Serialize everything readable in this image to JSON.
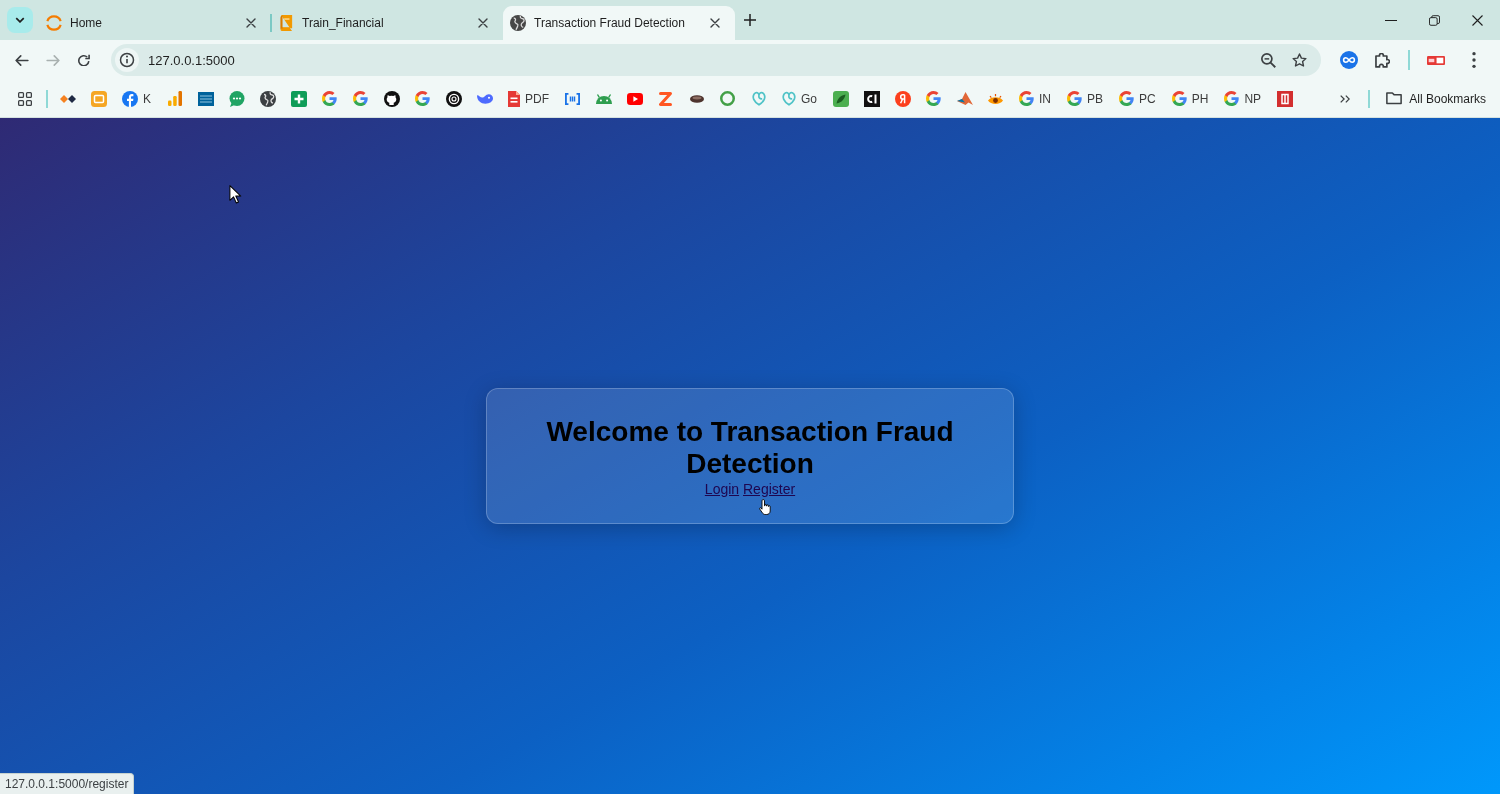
{
  "browser": {
    "tabs": [
      {
        "kind": "ring",
        "title": "Home",
        "selected": false
      },
      {
        "kind": "book",
        "title": "Train_Financial",
        "selected": false
      },
      {
        "kind": "globe",
        "title": "Transaction Fraud Detection",
        "selected": true
      }
    ],
    "nav_buttons": [
      {
        "kind": "back",
        "disabled": false
      },
      {
        "kind": "forward",
        "disabled": true
      },
      {
        "kind": "reload",
        "disabled": false
      }
    ],
    "address": {
      "url": "127.0.0.1:5000"
    },
    "bookmarks": [
      {
        "kind": "diamonds"
      },
      {
        "kind": "cardtile"
      },
      {
        "kind": "fcircle",
        "label": "K"
      },
      {
        "kind": "barchart"
      },
      {
        "kind": "stripedtile"
      },
      {
        "kind": "bubble"
      },
      {
        "kind": "globe"
      },
      {
        "kind": "plustile"
      },
      {
        "kind": "gletter"
      },
      {
        "kind": "gletter"
      },
      {
        "kind": "catcircle"
      },
      {
        "kind": "gletter"
      },
      {
        "kind": "knotcircle"
      },
      {
        "kind": "whale"
      },
      {
        "kind": "document",
        "label": "PDF"
      },
      {
        "kind": "brackets"
      },
      {
        "kind": "robot"
      },
      {
        "kind": "play"
      },
      {
        "kind": "zigzag"
      },
      {
        "kind": "oval"
      },
      {
        "kind": "ring"
      },
      {
        "kind": "swirl"
      },
      {
        "kind": "swirl",
        "label": "Go"
      },
      {
        "kind": "leaftile"
      },
      {
        "kind": "darktile"
      },
      {
        "kind": "badgecircle"
      },
      {
        "kind": "gletter"
      },
      {
        "kind": "peak"
      },
      {
        "kind": "eye"
      },
      {
        "kind": "gletter",
        "label": "IN"
      },
      {
        "kind": "gletter",
        "label": "PB"
      },
      {
        "kind": "gletter",
        "label": "PC"
      },
      {
        "kind": "gletter",
        "label": "PH"
      },
      {
        "kind": "gletter",
        "label": "NP"
      },
      {
        "kind": "paneltile"
      }
    ],
    "all_bookmarks": {
      "label": "All Bookmarks"
    }
  },
  "page": {
    "heading": "Welcome to Transaction Fraud Detection",
    "links": [
      {
        "label": "Login",
        "visited": true
      },
      {
        "label": "Register",
        "visited": true
      }
    ]
  },
  "status_bar": {
    "text": "127.0.0.1:5000/register"
  }
}
